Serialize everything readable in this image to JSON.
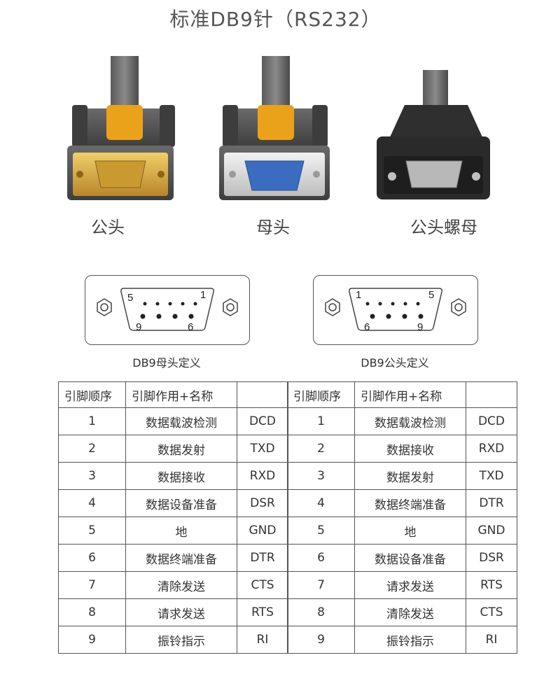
{
  "title": "标准DB9针（RS232）",
  "connectors": [
    {
      "label": "公头"
    },
    {
      "label": "母头"
    },
    {
      "label": "公头螺母"
    }
  ],
  "pinouts": [
    {
      "caption": "DB9母头定义",
      "top_left": "5",
      "top_right": "1",
      "bottom_left": "9",
      "bottom_right": "6"
    },
    {
      "caption": "DB9公头定义",
      "top_left": "1",
      "top_right": "5",
      "bottom_left": "6",
      "bottom_right": "9"
    }
  ],
  "tables": [
    {
      "headers": [
        "引脚顺序",
        "引脚作用+名称",
        ""
      ],
      "rows": [
        [
          "1",
          "数据载波检测",
          "DCD"
        ],
        [
          "2",
          "数据发射",
          "TXD"
        ],
        [
          "3",
          "数据接收",
          "RXD"
        ],
        [
          "4",
          "数据设备准备",
          "DSR"
        ],
        [
          "5",
          "地",
          "GND"
        ],
        [
          "6",
          "数据终端准备",
          "DTR"
        ],
        [
          "7",
          "清除发送",
          "CTS"
        ],
        [
          "8",
          "请求发送",
          "RTS"
        ],
        [
          "9",
          "振铃指示",
          "RI"
        ]
      ]
    },
    {
      "headers": [
        "引脚顺序",
        "引脚作用+名称",
        ""
      ],
      "rows": [
        [
          "1",
          "数据载波检测",
          "DCD"
        ],
        [
          "2",
          "数据接收",
          "RXD"
        ],
        [
          "3",
          "数据发射",
          "TXD"
        ],
        [
          "4",
          "数据终端准备",
          "DTR"
        ],
        [
          "5",
          "地",
          "GND"
        ],
        [
          "6",
          "数据设备准备",
          "DSR"
        ],
        [
          "7",
          "请求发送",
          "RTS"
        ],
        [
          "8",
          "清除发送",
          "CTS"
        ],
        [
          "9",
          "振铃指示",
          "RI"
        ]
      ]
    }
  ],
  "colors": {
    "shell_dark": "#4a4a4a",
    "grip_yellow": "#e9a21a",
    "gold_plate": "#d4a83a",
    "blue_socket": "#3b6cc0",
    "silver_plate": "#d8d8d8"
  }
}
